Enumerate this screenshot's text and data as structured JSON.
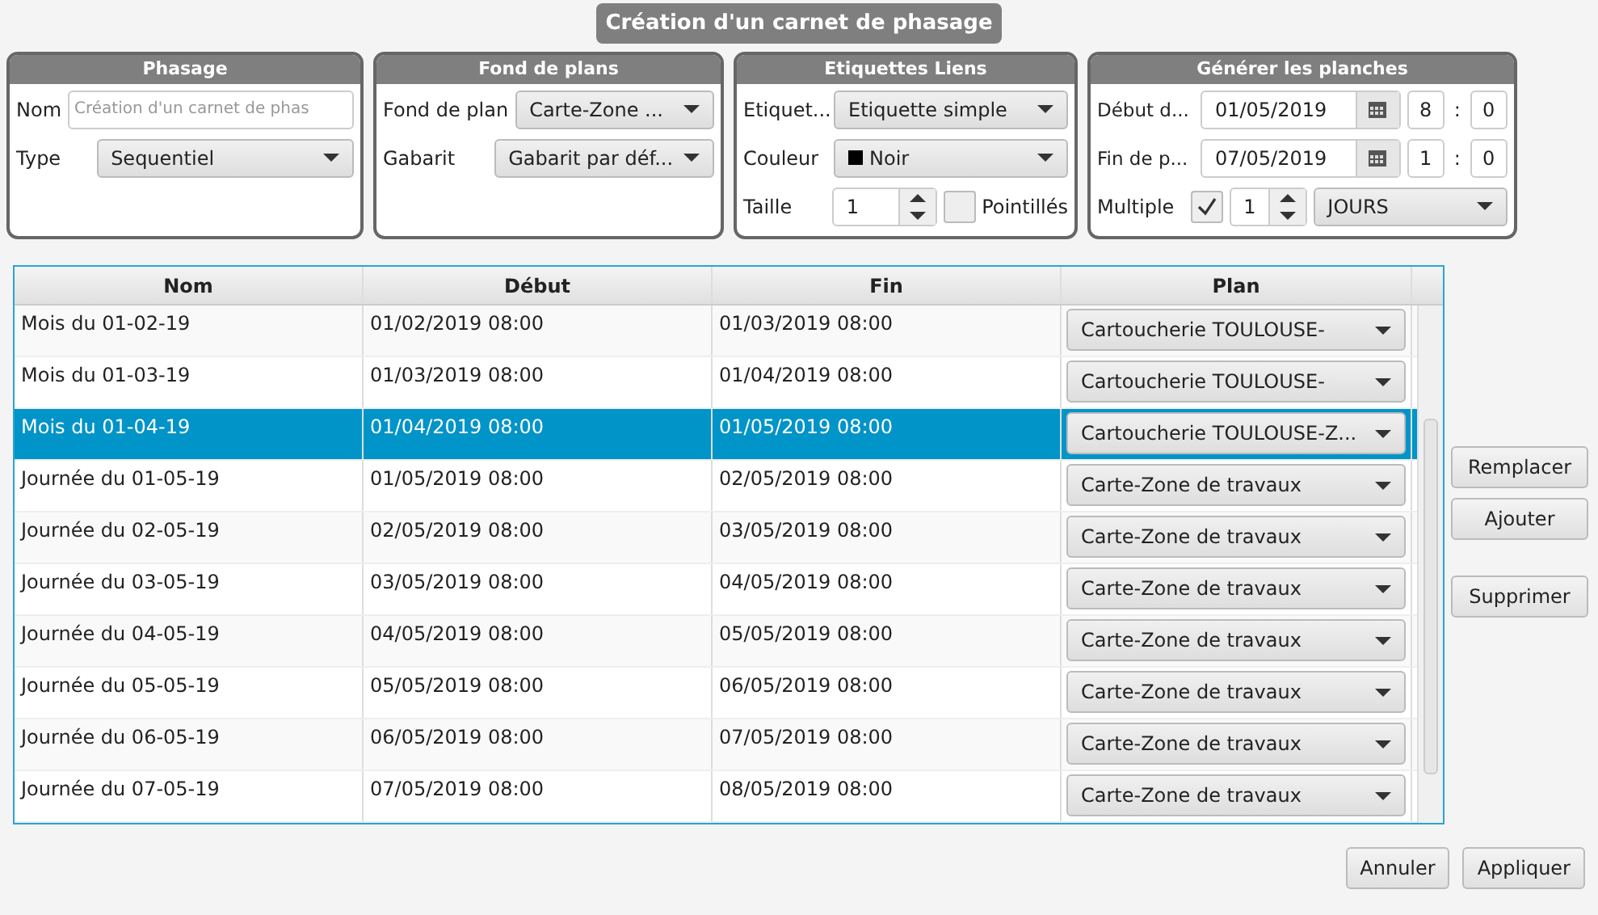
{
  "title": "Création d'un carnet de phasage",
  "phasage": {
    "title": "Phasage",
    "nom_label": "Nom",
    "nom_placeholder": "Création d'un carnet de phas",
    "type_label": "Type",
    "type_value": "Sequentiel"
  },
  "fond": {
    "title": "Fond de plans",
    "fond_label": "Fond de plan",
    "fond_value": "Carte-Zone ...",
    "gabarit_label": "Gabarit",
    "gabarit_value": "Gabarit par déf..."
  },
  "etiquettes": {
    "title": "Etiquettes Liens",
    "etiquette_label": "Etiquet...",
    "etiquette_value": "Etiquette simple",
    "couleur": {
      "label": "Couleur",
      "value": "Noir",
      "color": "#000000"
    },
    "taille_label": "Taille",
    "taille_value": "1",
    "pointilles_label": "Pointillés",
    "pointilles_checked": false
  },
  "generer": {
    "title": "Générer les planches",
    "debut_label": "Début d...",
    "debut_date": "01/05/2019",
    "debut_hour": "8",
    "debut_min": "0",
    "fin_label": "Fin de p...",
    "fin_date": "07/05/2019",
    "fin_hour": "1",
    "fin_min": "0",
    "separator": ":",
    "multiple_label": "Multiple",
    "multiple_checked": true,
    "multiple_value": "1",
    "unit_value": "JOURS"
  },
  "table": {
    "columns": [
      "Nom",
      "Début",
      "Fin",
      "Plan"
    ],
    "rows": [
      {
        "nom": "Mois du 01-02-19",
        "debut": "01/02/2019 08:00",
        "fin": "01/03/2019 08:00",
        "plan": "Cartoucherie TOULOUSE-",
        "selected": false
      },
      {
        "nom": "Mois du 01-03-19",
        "debut": "01/03/2019 08:00",
        "fin": "01/04/2019 08:00",
        "plan": "Cartoucherie TOULOUSE-",
        "selected": false
      },
      {
        "nom": "Mois du 01-04-19",
        "debut": "01/04/2019 08:00",
        "fin": "01/05/2019 08:00",
        "plan": "Cartoucherie TOULOUSE-Z...",
        "selected": true
      },
      {
        "nom": "Journée du 01-05-19",
        "debut": "01/05/2019 08:00",
        "fin": "02/05/2019 08:00",
        "plan": "Carte-Zone de travaux",
        "selected": false
      },
      {
        "nom": "Journée du 02-05-19",
        "debut": "02/05/2019 08:00",
        "fin": "03/05/2019 08:00",
        "plan": "Carte-Zone de travaux",
        "selected": false
      },
      {
        "nom": "Journée du 03-05-19",
        "debut": "03/05/2019 08:00",
        "fin": "04/05/2019 08:00",
        "plan": "Carte-Zone de travaux",
        "selected": false
      },
      {
        "nom": "Journée du 04-05-19",
        "debut": "04/05/2019 08:00",
        "fin": "05/05/2019 08:00",
        "plan": "Carte-Zone de travaux",
        "selected": false
      },
      {
        "nom": "Journée du 05-05-19",
        "debut": "05/05/2019 08:00",
        "fin": "06/05/2019 08:00",
        "plan": "Carte-Zone de travaux",
        "selected": false
      },
      {
        "nom": "Journée du 06-05-19",
        "debut": "06/05/2019 08:00",
        "fin": "07/05/2019 08:00",
        "plan": "Carte-Zone de travaux",
        "selected": false
      },
      {
        "nom": "Journée du 07-05-19",
        "debut": "07/05/2019 08:00",
        "fin": "08/05/2019 08:00",
        "plan": "Carte-Zone de travaux",
        "selected": false
      }
    ]
  },
  "side_buttons": [
    "Remplacer",
    "Ajouter",
    "Supprimer"
  ],
  "footer_buttons": [
    "Annuler",
    "Appliquer"
  ]
}
